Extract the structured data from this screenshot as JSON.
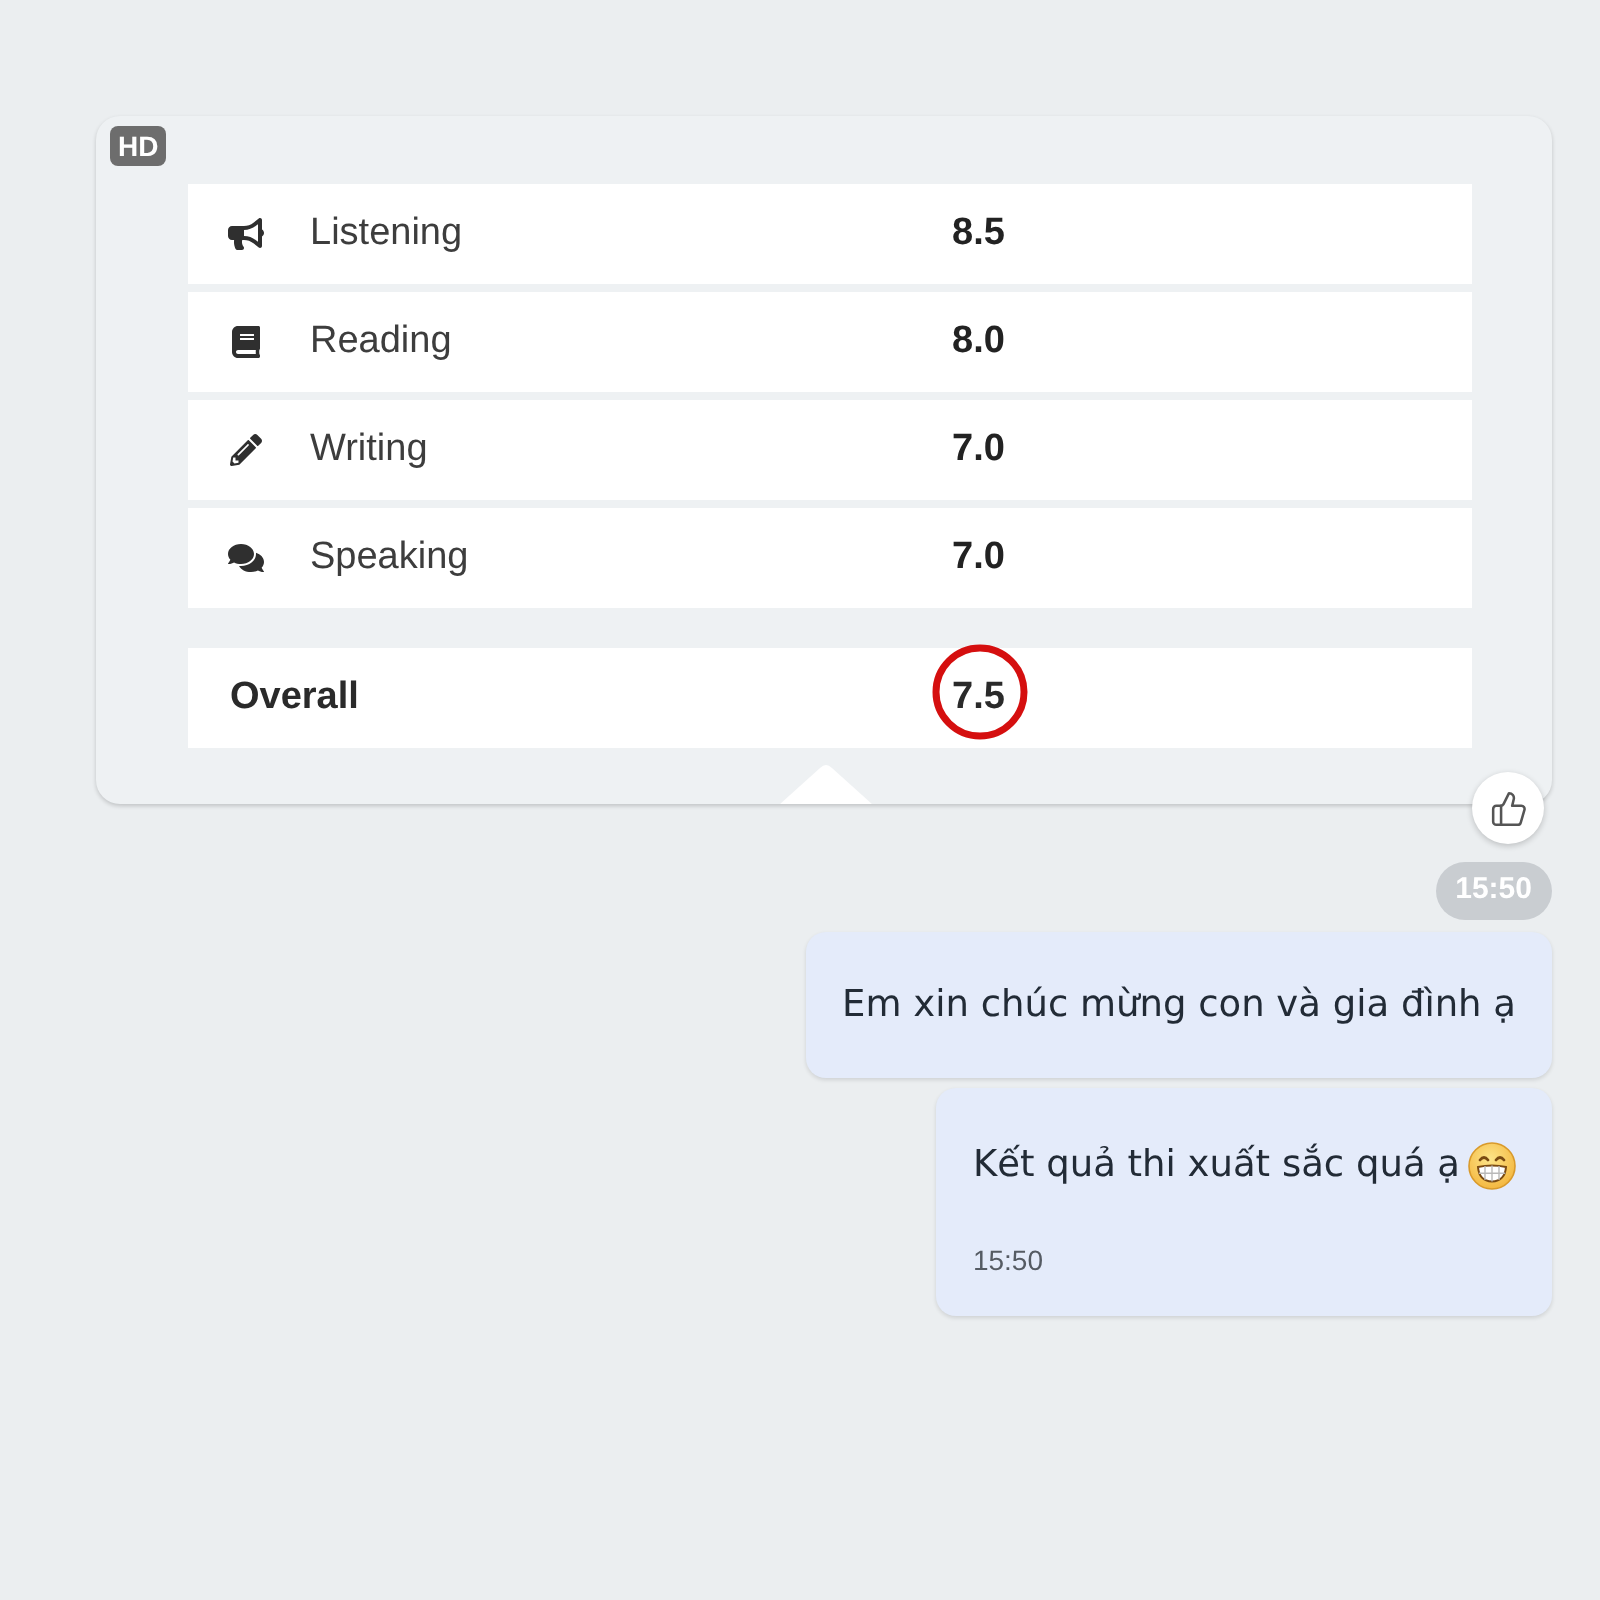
{
  "image": {
    "badge": "HD",
    "scores": [
      {
        "kind": "listening",
        "skill": "Listening",
        "score": "8.5"
      },
      {
        "kind": "reading",
        "skill": "Reading",
        "score": "8.0"
      },
      {
        "kind": "writing",
        "skill": "Writing",
        "score": "7.0"
      },
      {
        "kind": "speaking",
        "skill": "Speaking",
        "score": "7.0"
      }
    ],
    "overall": {
      "label": "Overall",
      "score": "7.5",
      "circled": true
    }
  },
  "timestamp": "15:50",
  "messages": [
    {
      "text": "Em xin chúc mừng con và gia đình ạ",
      "has_emoji": false
    },
    {
      "text": "Kết quả thi xuất sắc quá ạ",
      "has_emoji": true,
      "time": "15:50"
    }
  ]
}
